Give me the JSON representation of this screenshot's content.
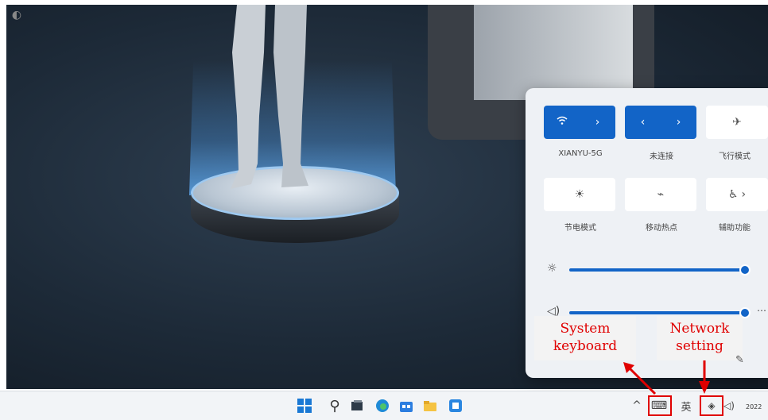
{
  "quick_settings": {
    "tiles_row1": [
      {
        "label": "XIANYU-5G",
        "icon": "wifi-icon",
        "chevron": "›",
        "state": "on"
      },
      {
        "label": "未连接",
        "icon": "bluetooth-icon",
        "chevron": "›",
        "state": "on"
      },
      {
        "label": "飞行模式",
        "icon": "airplane-icon",
        "state": "off"
      }
    ],
    "tiles_row2": [
      {
        "label": "节电模式",
        "icon": "battery-saver-icon",
        "state": "off"
      },
      {
        "label": "移动热点",
        "icon": "hotspot-icon",
        "state": "off"
      },
      {
        "label": "辅助功能",
        "icon": "accessibility-icon",
        "chevron": "›",
        "state": "off"
      }
    ],
    "brightness": {
      "icon": "brightness-icon",
      "level_percent": 95
    },
    "volume": {
      "icon": "volume-icon",
      "level_percent": 95
    }
  },
  "annotations": {
    "system_keyboard": "System keyboard",
    "network_setting": "Network setting",
    "color": "#e00000"
  },
  "taskbar": {
    "apps": [
      "windows-start-icon",
      "search-icon",
      "task-view-icon",
      "edge-icon",
      "store-icon",
      "file-explorer-icon",
      "app-icon"
    ],
    "tray": {
      "chevron": "^",
      "ime_label": "英",
      "clock_fragment": "2022"
    }
  },
  "colors": {
    "accent": "#1264c7",
    "panel": "#eef1f5",
    "taskbar": "#f2f4f7"
  }
}
